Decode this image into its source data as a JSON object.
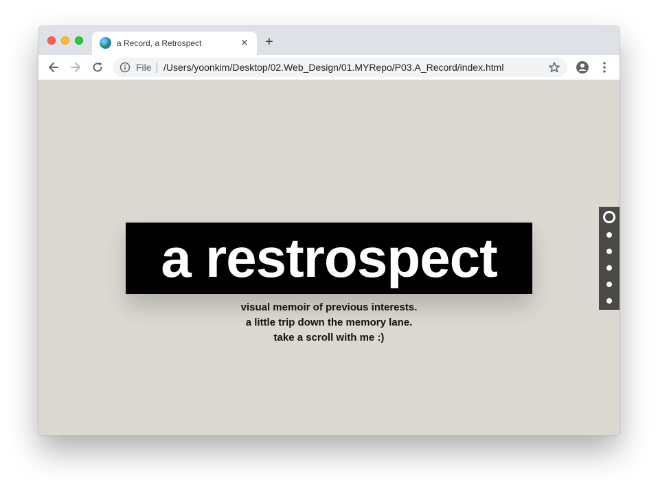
{
  "browser": {
    "tab_title": "a Record, a Retrospect",
    "tab_close_glyph": "✕",
    "new_tab_glyph": "+",
    "address": {
      "scheme_label": "File",
      "url": "/Users/yoonkim/Desktop/02.Web_Design/01.MYRepo/P03.A_Record/index.html"
    },
    "icons": {
      "back": "arrow-left-icon",
      "forward": "arrow-right-icon",
      "reload": "reload-icon",
      "info": "info-icon",
      "bookmark": "star-icon",
      "account": "account-icon",
      "menu": "kebab-menu-icon",
      "favicon": "globe-icon"
    }
  },
  "page": {
    "hero_title": "a restrospect",
    "subtitle_lines": [
      "visual memoir of previous interests.",
      "a little trip down the memory lane.",
      "take a scroll with me :)"
    ],
    "section_nav": {
      "total_sections": 6,
      "active_index": 0
    }
  },
  "colors": {
    "page_background": "#dcd9d2",
    "hero_background": "#000000",
    "hero_text": "#ffffff",
    "nav_background": "#4b4a47",
    "tabbar_background": "#dee1e6"
  }
}
